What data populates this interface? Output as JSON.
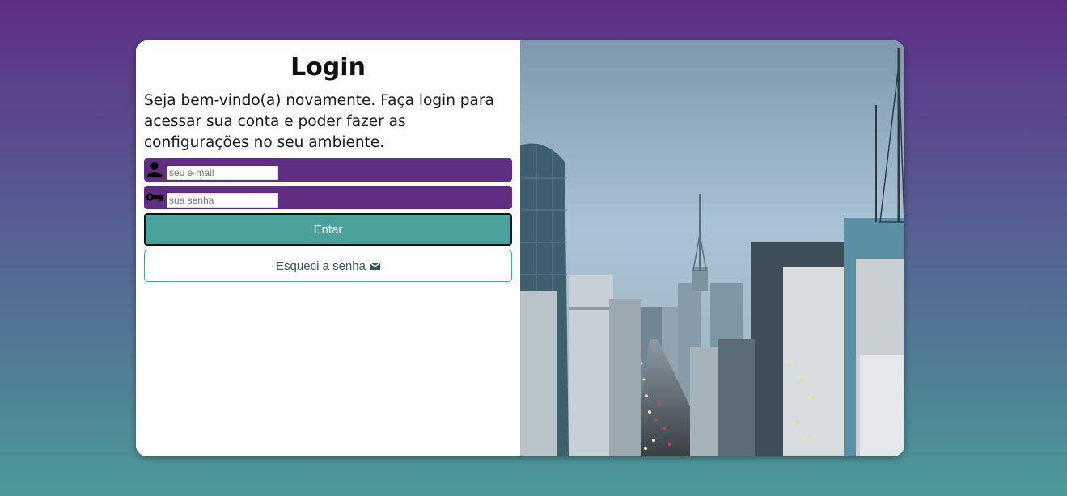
{
  "login": {
    "title": "Login",
    "description": "Seja bem-vindo(a) novamente. Faça login para acessar sua conta e poder fazer as configurações no seu ambiente.",
    "email_placeholder": "seu e-mail",
    "password_placeholder": "sua senha",
    "enter_label": "Entar",
    "forgot_label": "Esqueci a senha"
  },
  "icons": {
    "email_field": "user-icon",
    "password_field": "key-icon",
    "forgot": "envelope-icon"
  },
  "colors": {
    "field_bg": "#612f82",
    "accent": "#4ba19b",
    "bg_top": "#5e2e85",
    "bg_bottom": "#4a9a98"
  }
}
